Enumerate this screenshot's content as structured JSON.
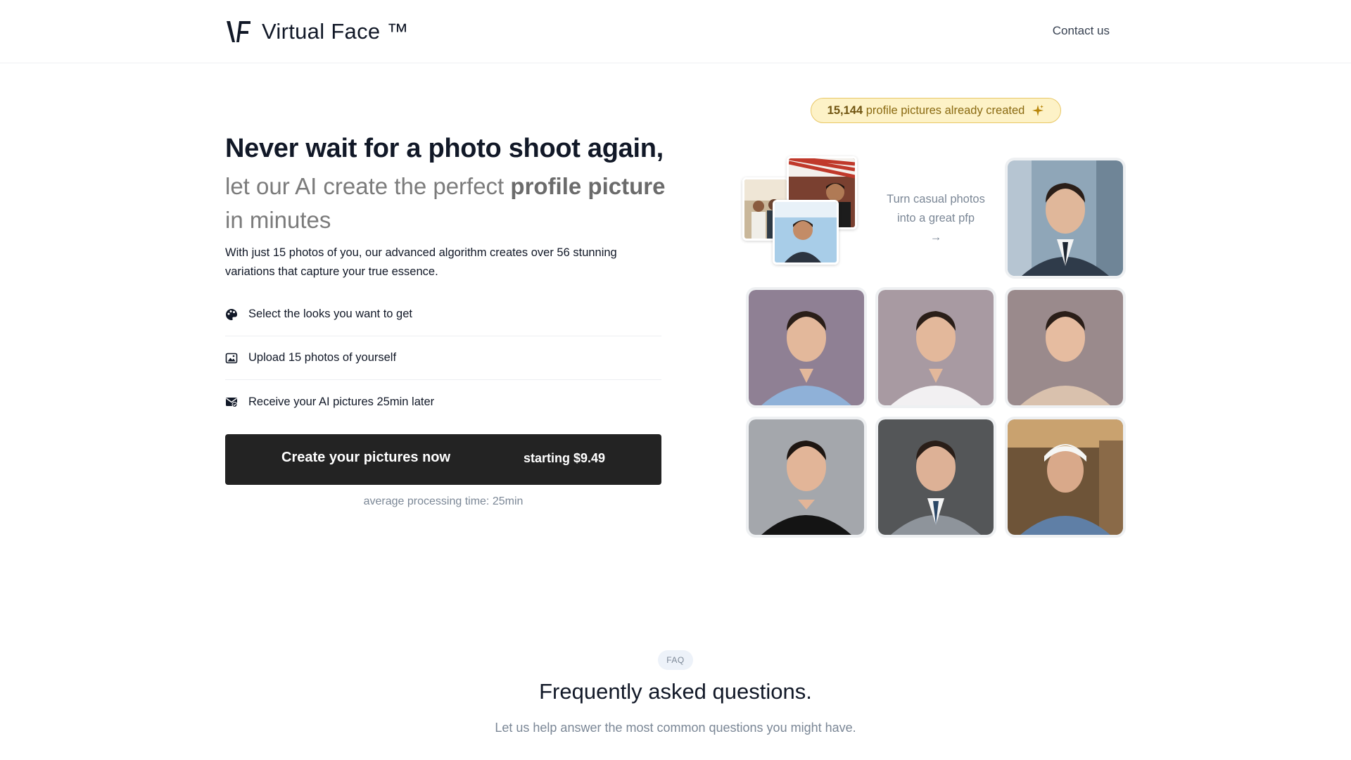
{
  "header": {
    "brand": "Virtual Face ™",
    "contact_label": "Contact us"
  },
  "hero": {
    "title": "Never wait for a photo shoot again,",
    "subtitle_part1": "let our AI create the perfect ",
    "subtitle_bold": "profile picture",
    "subtitle_part2": "in minutes",
    "description": "With just 15 photos of you, our advanced algorithm creates over 56 stunning variations that capture your true essence.",
    "steps": [
      {
        "icon": "palette-icon",
        "label": "Select the looks you want to get"
      },
      {
        "icon": "image-icon",
        "label": "Upload 15 photos of yourself"
      },
      {
        "icon": "mail-check-icon",
        "label": "Receive your AI pictures 25min later"
      }
    ],
    "cta_label": "Create your pictures now",
    "cta_price": "starting $9.49",
    "processing_note": "average processing time: 25min"
  },
  "showcase": {
    "badge_count": "15,144",
    "badge_text": "profile pictures already created",
    "turn_text_line1": "Turn casual photos",
    "turn_text_line2": "into a great pfp",
    "arrow": "→"
  },
  "faq": {
    "tag": "FAQ",
    "title": "Frequently asked questions.",
    "subtitle": "Let us help answer the most common questions you might have."
  },
  "colors": {
    "cta_bg": "#232323",
    "badge_bg": "#fdf2c7",
    "badge_border": "#e8c766",
    "muted_text": "#7b8796"
  }
}
